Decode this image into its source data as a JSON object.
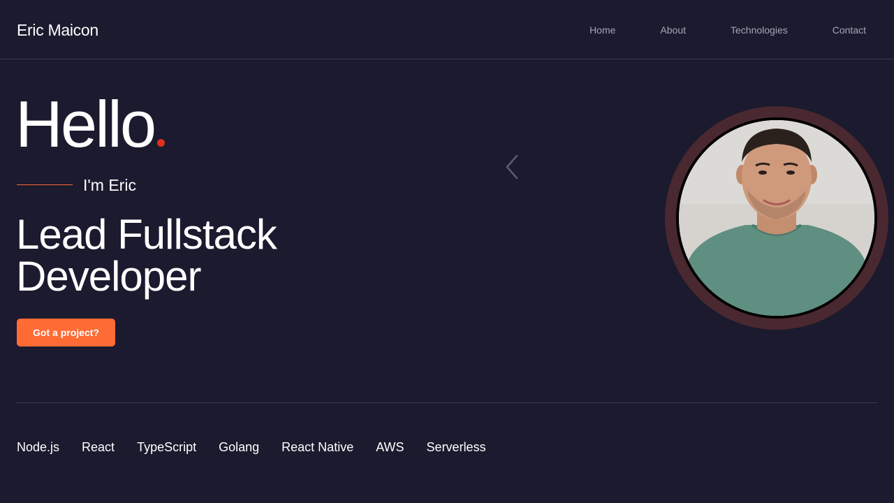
{
  "header": {
    "brand": "Eric Maicon",
    "nav": [
      {
        "label": "Home"
      },
      {
        "label": "About"
      },
      {
        "label": "Technologies"
      },
      {
        "label": "Contact"
      }
    ]
  },
  "hero": {
    "greeting": "Hello",
    "intro": "I'm Eric",
    "role_line1": "Lead Fullstack",
    "role_line2": "Developer",
    "cta_label": "Got a project?"
  },
  "technologies": [
    "Node.js",
    "React",
    "TypeScript",
    "Golang",
    "React Native",
    "AWS",
    "Serverless"
  ],
  "icons": {
    "carousel_prev": "chevron-left-icon"
  },
  "colors": {
    "background": "#1b1a2e",
    "accent": "#ff6b35",
    "dot": "#e0301c",
    "ring": "#4a2830",
    "nav_text": "#a6a6b8",
    "divider": "#3a3a5c"
  }
}
